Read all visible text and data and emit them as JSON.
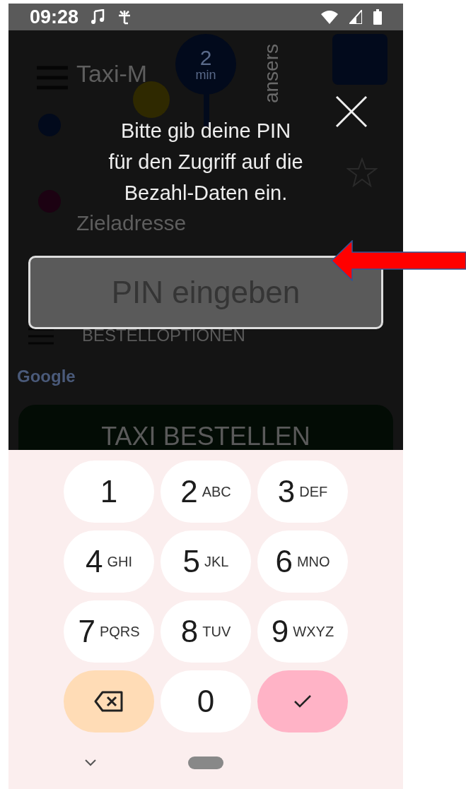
{
  "status_bar": {
    "time": "09:28"
  },
  "background_app": {
    "title": "Taxi-M",
    "eta": {
      "value": "2",
      "unit": "min"
    },
    "map_label": "ansers",
    "destination": "Zieladresse",
    "options": "BESTELLOPTIONEN",
    "map_attribution": "Google",
    "order_button": "TAXI BESTELLEN"
  },
  "dialog": {
    "message_lines": [
      "Bitte gib deine PIN",
      "für den Zugriff auf die",
      "Bezahl-Daten ein."
    ],
    "pin_field": {
      "placeholder": "PIN eingeben"
    }
  },
  "keypad": {
    "keys": [
      {
        "kind": "digit",
        "digit": "1"
      },
      {
        "kind": "digit",
        "digit": "2",
        "letters": "ABC"
      },
      {
        "kind": "digit",
        "digit": "3",
        "letters": "DEF"
      },
      {
        "kind": "digit",
        "digit": "4",
        "letters": "GHI"
      },
      {
        "kind": "digit",
        "digit": "5",
        "letters": "JKL"
      },
      {
        "kind": "digit",
        "digit": "6",
        "letters": "MNO"
      },
      {
        "kind": "digit",
        "digit": "7",
        "letters": "PQRS"
      },
      {
        "kind": "digit",
        "digit": "8",
        "letters": "TUV"
      },
      {
        "kind": "digit",
        "digit": "9",
        "letters": "WXYZ"
      },
      {
        "kind": "backspace"
      },
      {
        "kind": "digit",
        "digit": "0"
      },
      {
        "kind": "confirm"
      }
    ]
  }
}
